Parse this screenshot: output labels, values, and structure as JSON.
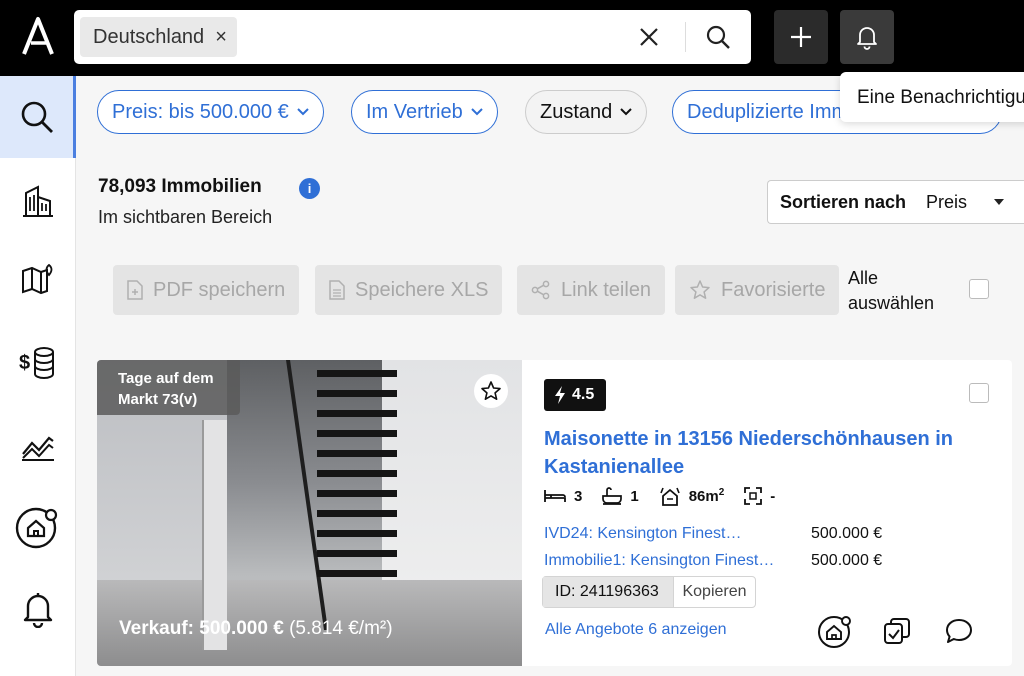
{
  "search": {
    "chip_label": "Deutschland",
    "chip_remove": "×"
  },
  "notification": {
    "text": "Eine Benachrichtigung"
  },
  "filters": [
    {
      "label": "Preis: bis 500.000 €",
      "active": true
    },
    {
      "label": "Im Vertrieb",
      "active": true
    },
    {
      "label": "Zustand",
      "active": false
    },
    {
      "label": "Deduplizierte Immobilien",
      "active": true
    }
  ],
  "results": {
    "count": "78,093 Immobilien",
    "info": "i",
    "subtitle": "Im sichtbaren Bereich"
  },
  "sort": {
    "label": "Sortieren nach",
    "value": "Preis"
  },
  "actions": {
    "pdf": "PDF speichern",
    "xls": "Speichere XLS",
    "share": "Link teilen",
    "favorites": "Favorisierte",
    "select_all_line1": "Alle",
    "select_all_line2": "auswählen"
  },
  "listing": {
    "days_badge_line1": "Tage auf dem",
    "days_badge_line2": "Markt 73(v)",
    "price_bold": "Verkauf: 500.000 €",
    "price_per_sqm": "(5.814 €/m²)",
    "score": "4.5",
    "title": "Maisonette in 13156 Niederschönhausen in Kastanienallee",
    "bedrooms": "3",
    "bathrooms": "1",
    "area": "86m",
    "area_sup": "2",
    "plot": "-",
    "sources": [
      {
        "name": "IVD24: Kensington Finest…",
        "price": "500.000 €"
      },
      {
        "name": "Immobilie1: Kensington Finest…",
        "price": "500.000 €"
      }
    ],
    "id_label": "ID: 241196363",
    "copy_label": "Kopieren",
    "all_offers": "Alle Angebote 6 anzeigen"
  },
  "colors": {
    "accent": "#2f6fd6",
    "topbar": "#000000",
    "sidebar_active": "#dde8fb"
  },
  "icons": [
    "logo-icon",
    "search-icon",
    "close-icon",
    "plus-icon",
    "bell-icon",
    "building-icon",
    "map-icon",
    "money-stack-icon",
    "chart-icon",
    "home-badge-icon",
    "star-icon",
    "bolt-icon",
    "bed-icon",
    "bath-icon",
    "area-icon",
    "plot-icon",
    "copy-check-icon",
    "chat-icon"
  ]
}
